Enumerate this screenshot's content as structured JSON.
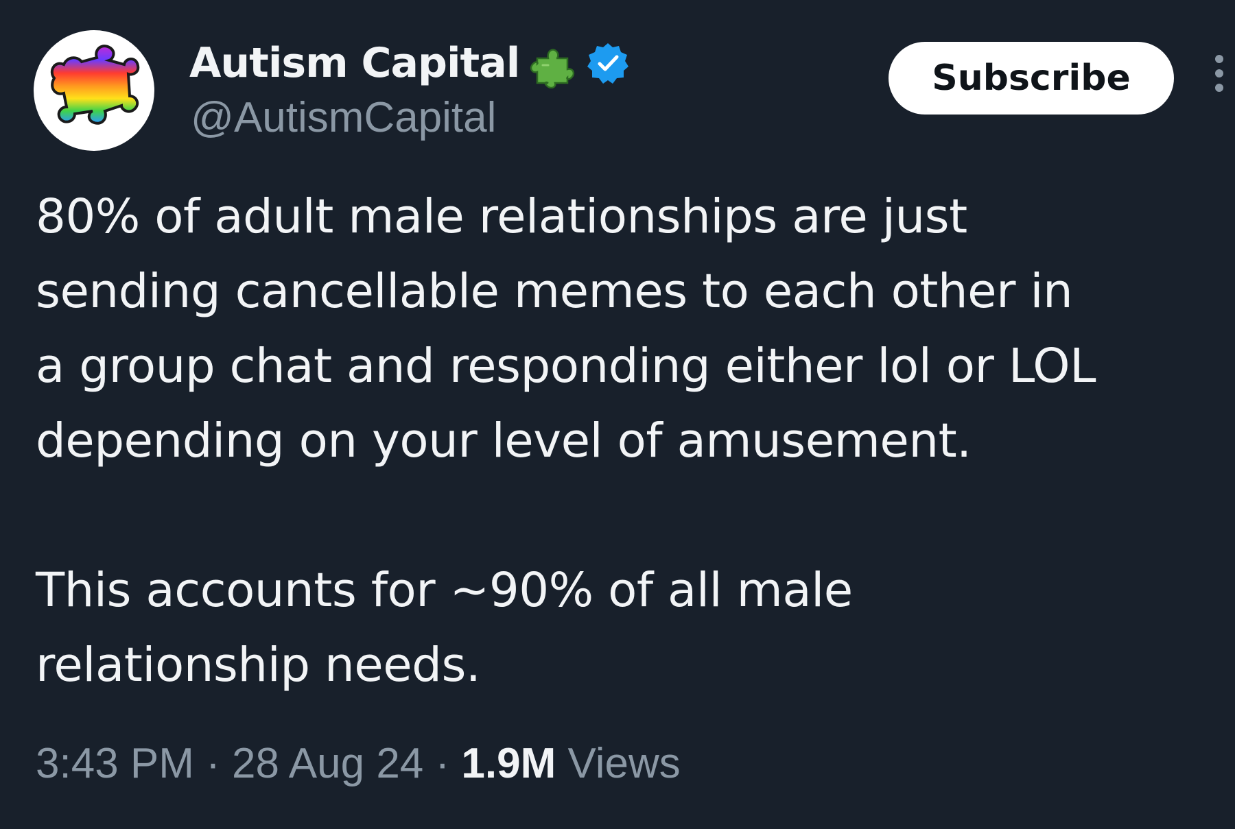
{
  "author": {
    "display_name": "Autism Capital",
    "handle": "@AutismCapital",
    "name_emoji": "puzzle-piece-icon",
    "verified": true,
    "avatar": "rainbow-puzzle-piece"
  },
  "actions": {
    "subscribe_label": "Subscribe",
    "more_icon": "more-vertical-icon"
  },
  "tweet": {
    "paragraphs": [
      "80% of adult male relationships are just\nsending cancellable memes to each other in\na group chat and responding either lol or LOL\ndepending on your level of amusement.",
      "This accounts for ~90% of all male\nrelationship needs."
    ]
  },
  "meta": {
    "time": "3:43 PM",
    "separator": " · ",
    "date": "28 Aug 24",
    "views_count": "1.9M",
    "views_label": " Views"
  },
  "colors": {
    "background": "#18202b",
    "text_primary": "#f2f4f6",
    "text_secondary": "#8b98a5",
    "verified_badge": "#1d9bf0",
    "subscribe_bg": "#ffffff"
  }
}
